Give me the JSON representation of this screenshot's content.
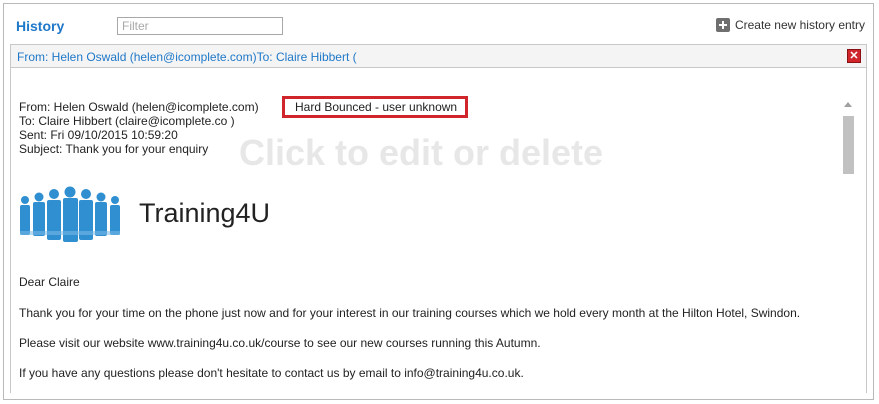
{
  "header": {
    "title": "History",
    "filter_placeholder": "Filter",
    "create_label": "Create new history entry"
  },
  "entry": {
    "summary": "From: Helen Oswald (helen@icomplete.com)To: Claire Hibbert (",
    "from": "From: Helen Oswald (helen@icomplete.com)",
    "to": "To: Claire Hibbert (claire@icomplete.co )",
    "sent": "Sent: Fri 09/10/2015 10:59:20",
    "subject": "Subject: Thank you for your enquiry",
    "status": "Hard Bounced - user unknown",
    "hint": "Click to edit or delete"
  },
  "email": {
    "logo_text": "Training4U",
    "greeting": "Dear Claire",
    "para1": "Thank you for your time on the phone just now and for your interest in our training courses which we hold every month at the Hilton Hotel, Swindon.",
    "para2": "Please visit our website www.training4u.co.uk/course to see our new courses running this Autumn.",
    "para3": "If you have any questions please don't hesitate to contact us by email to info@training4u.co.uk."
  },
  "colors": {
    "accent_blue": "#1f78c8",
    "status_red": "#d0262b",
    "logo_blue": "#2f8fd0"
  },
  "icons": {
    "create": "plus-icon",
    "close": "close-icon",
    "logo": "people-group-logo"
  }
}
